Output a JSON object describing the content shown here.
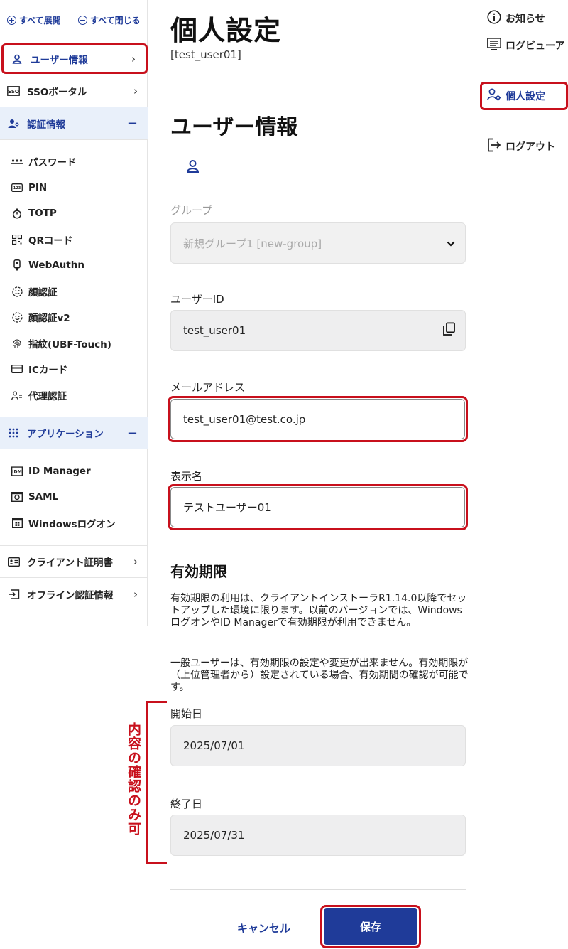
{
  "sidebar": {
    "expand_all": "すべて展開",
    "collapse_all": "すべて閉じる",
    "top": {
      "user_info": "ユーザー情報",
      "sso_portal": "SSOポータル",
      "auth_info": "認証情報",
      "applications": "アプリケーション",
      "client_cert": "クライアント証明書",
      "offline_auth": "オフライン認証情報"
    },
    "auth_items": [
      "パスワード",
      "PIN",
      "TOTP",
      "QRコード",
      "WebAuthn",
      "顔認証",
      "顔認証v2",
      "指紋(UBF-Touch)",
      "ICカード",
      "代理認証"
    ],
    "app_items": [
      "ID Manager",
      "SAML",
      "Windowsログオン"
    ]
  },
  "main": {
    "title": "個人設定",
    "subtitle": "[test_user01]",
    "section_title": "ユーザー情報",
    "group": {
      "label": "グループ",
      "value": "新規グループ1 [new-group]"
    },
    "user_id": {
      "label": "ユーザーID",
      "value": "test_user01"
    },
    "email": {
      "label": "メールアドレス",
      "value": "test_user01@test.co.jp"
    },
    "display_name": {
      "label": "表示名",
      "value": "テストユーザー01"
    },
    "validity": {
      "title": "有効期限",
      "note1": "有効期限の利用は、クライアントインストーラR1.14.0以降でセットアップした環境に限ります。以前のバージョンでは、WindowsログオンやID Managerで有効期限が利用できません。",
      "note2": "一般ユーザーは、有効期限の設定や変更が出来ません。有効期限が（上位管理者から）設定されている場合、有効期間の確認が可能です。",
      "start_label": "開始日",
      "start_value": "2025/07/01",
      "end_label": "終了日",
      "end_value": "2025/07/31"
    },
    "annotation": "内容の確認のみ可",
    "cancel": "キャンセル",
    "save": "保存"
  },
  "right_nav": {
    "news": "お知らせ",
    "log_viewer": "ログビューア",
    "personal_settings": "個人設定",
    "logout": "ログアウト"
  },
  "colors": {
    "accent": "#1f3b99",
    "highlight": "#c8101c",
    "section_bg": "#e9f0fa"
  }
}
